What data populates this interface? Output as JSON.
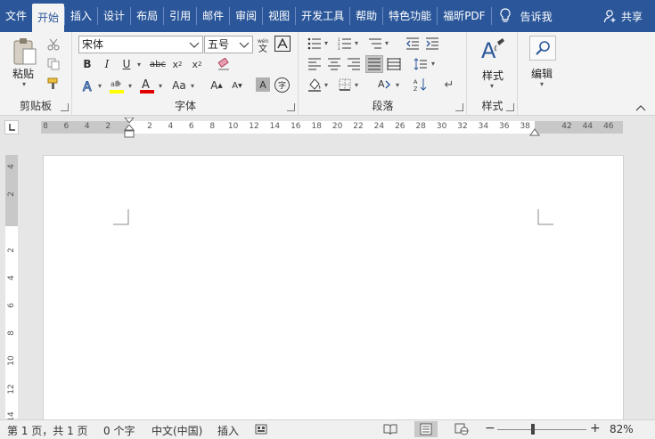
{
  "tabs": [
    "文件",
    "开始",
    "插入",
    "设计",
    "布局",
    "引用",
    "邮件",
    "审阅",
    "视图",
    "开发工具",
    "帮助",
    "特色功能",
    "福昕PDF"
  ],
  "active_tab": 1,
  "tell_me": "告诉我",
  "share": "共享",
  "clipboard": {
    "paste": "粘贴",
    "label": "剪贴板"
  },
  "font": {
    "name": "宋体",
    "size": "五号",
    "label": "字体"
  },
  "paragraph": {
    "label": "段落"
  },
  "styles": {
    "button": "样式",
    "label": "样式"
  },
  "editing": {
    "button": "编辑"
  },
  "ruler_h": [
    "8",
    "6",
    "4",
    "2",
    "",
    "2",
    "4",
    "6",
    "8",
    "10",
    "12",
    "14",
    "16",
    "18",
    "20",
    "22",
    "24",
    "26",
    "28",
    "30",
    "32",
    "34",
    "36",
    "38",
    "",
    "42",
    "44",
    "46"
  ],
  "ruler_v": [
    "4",
    "2",
    "",
    "2",
    "4",
    "6",
    "8",
    "10",
    "12",
    "14"
  ],
  "status": {
    "page": "第 1 页，共 1 页",
    "words": "0 个字",
    "lang": "中文(中国)",
    "mode": "插入",
    "zoom_minus": "−",
    "zoom_plus": "+",
    "zoom": "82%"
  },
  "zoom_level": 0.82,
  "colors": {
    "accent": "#2b579a",
    "highlight": "#ffff00",
    "font_color": "#e00000"
  }
}
